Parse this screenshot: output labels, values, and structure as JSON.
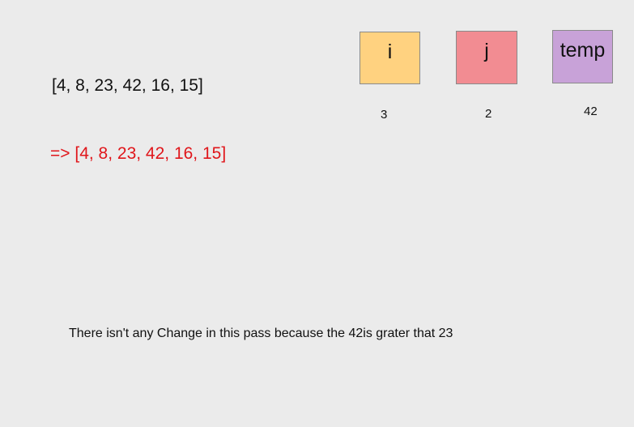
{
  "array_line": "[4, 8, 23, 42, 16, 15]",
  "result_line": "=> [4, 8, 23, 42, 16, 15]",
  "variables": [
    {
      "label": "i",
      "value": "3",
      "color": "#ffd280"
    },
    {
      "label": "j",
      "value": "2",
      "color": "#f28c92"
    },
    {
      "label": "temp",
      "value": "42",
      "color": "#c8a2d8"
    }
  ],
  "note": "There isn't any Change in this pass because the 42is grater that 23",
  "colors": {
    "background": "#ebebeb",
    "result_text": "#e0161b"
  }
}
